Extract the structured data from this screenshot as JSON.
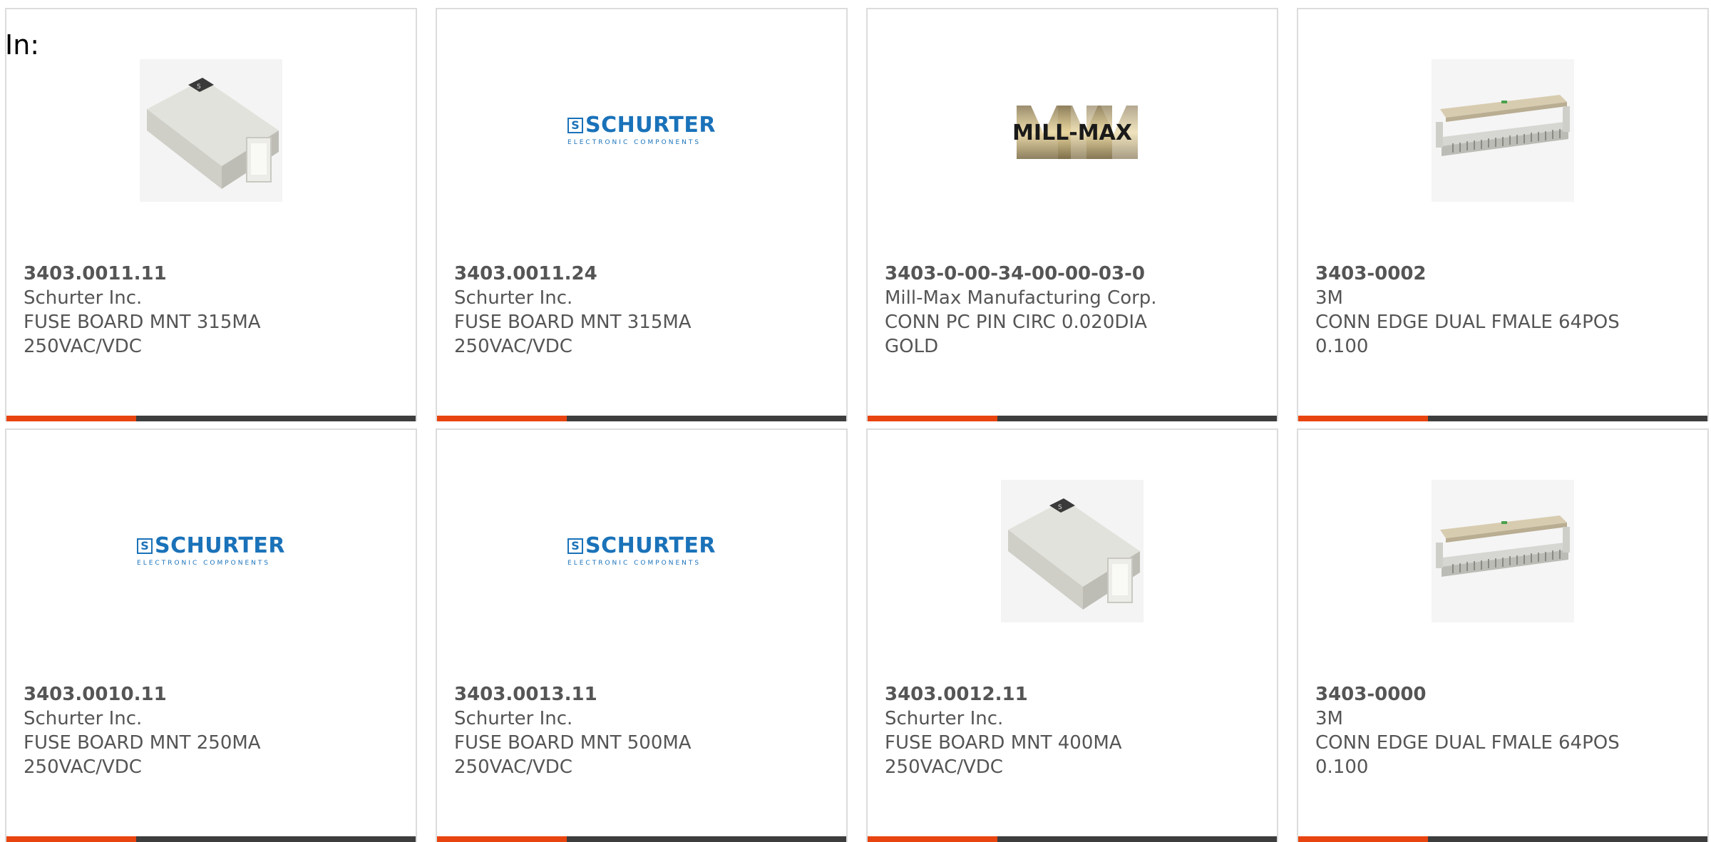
{
  "filter": {
    "label": "In:"
  },
  "products": [
    {
      "part": "3403.0011.11",
      "manufacturer": "Schurter Inc.",
      "description": "FUSE BOARD MNT 315MA\n250VAC/VDC",
      "image": "fuse-holder-icon"
    },
    {
      "part": "3403.0011.24",
      "manufacturer": "Schurter Inc.",
      "description": "FUSE BOARD MNT 315MA\n250VAC/VDC",
      "image": "schurter-logo",
      "logo_name": "SCHURTER",
      "logo_sub": "ELECTRONIC COMPONENTS",
      "logo_mark": "S"
    },
    {
      "part": "3403-0-00-34-00-00-03-0",
      "manufacturer": "Mill-Max Manufacturing Corp.",
      "description": "CONN PC PIN CIRC 0.020DIA\nGOLD",
      "image": "millmax-logo",
      "logo_name": "MILL-MAX"
    },
    {
      "part": "3403-0002",
      "manufacturer": "3M",
      "description": "CONN EDGE DUAL FMALE 64POS\n0.100",
      "image": "edge-connector-icon"
    },
    {
      "part": "3403.0010.11",
      "manufacturer": "Schurter Inc.",
      "description": "FUSE BOARD MNT 250MA\n250VAC/VDC",
      "image": "schurter-logo",
      "logo_name": "SCHURTER",
      "logo_sub": "ELECTRONIC COMPONENTS",
      "logo_mark": "S"
    },
    {
      "part": "3403.0013.11",
      "manufacturer": "Schurter Inc.",
      "description": "FUSE BOARD MNT 500MA\n250VAC/VDC",
      "image": "schurter-logo",
      "logo_name": "SCHURTER",
      "logo_sub": "ELECTRONIC COMPONENTS",
      "logo_mark": "S"
    },
    {
      "part": "3403.0012.11",
      "manufacturer": "Schurter Inc.",
      "description": "FUSE BOARD MNT 400MA\n250VAC/VDC",
      "image": "fuse-holder-icon"
    },
    {
      "part": "3403-0000",
      "manufacturer": "3M",
      "description": "CONN EDGE DUAL FMALE 64POS\n0.100",
      "image": "edge-connector-icon"
    }
  ],
  "colors": {
    "accent": "#e8440f",
    "bar": "#3d3d3d",
    "border": "#dcdcdc",
    "text": "#555555",
    "schurter_blue": "#1a72b9"
  }
}
